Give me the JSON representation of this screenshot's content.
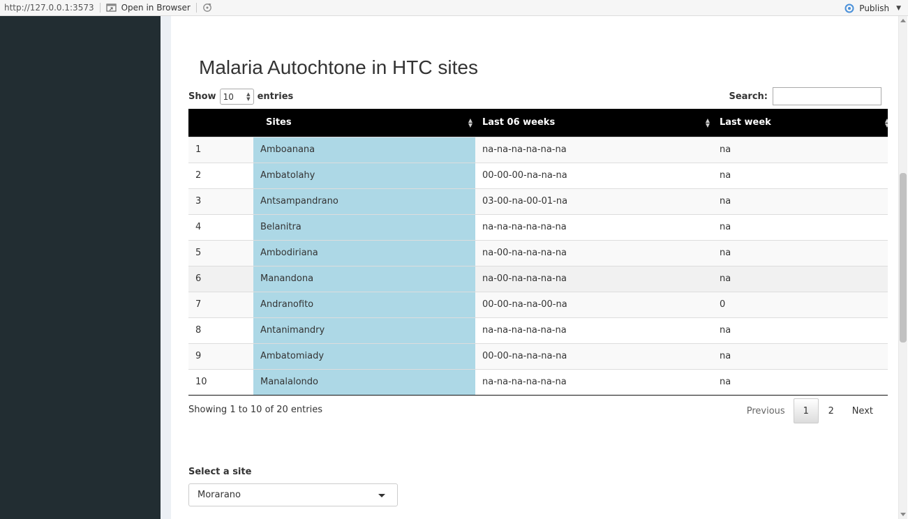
{
  "toolbar": {
    "url": "http://127.0.0.1:3573",
    "open_browser_label": "Open in Browser",
    "publish_label": "Publish"
  },
  "page": {
    "title": "Malaria Autochtone in HTC sites"
  },
  "table_controls": {
    "show_label": "Show",
    "entries_label": "entries",
    "page_length": "10",
    "search_label": "Search:",
    "search_value": ""
  },
  "table": {
    "columns": [
      "",
      "Sites",
      "Last 06 weeks",
      "Last week"
    ],
    "rows": [
      {
        "index": "1",
        "site": "Amboanana",
        "last6": "na-na-na-na-na-na",
        "last": "na"
      },
      {
        "index": "2",
        "site": "Ambatolahy",
        "last6": "00-00-00-na-na-na",
        "last": "na"
      },
      {
        "index": "3",
        "site": "Antsampandrano",
        "last6": "03-00-na-00-01-na",
        "last": "na"
      },
      {
        "index": "4",
        "site": "Belanitra",
        "last6": "na-na-na-na-na-na",
        "last": "na"
      },
      {
        "index": "5",
        "site": "Ambodiriana",
        "last6": "na-00-na-na-na-na",
        "last": "na"
      },
      {
        "index": "6",
        "site": "Manandona",
        "last6": "na-00-na-na-na-na",
        "last": "na"
      },
      {
        "index": "7",
        "site": "Andranofito",
        "last6": "00-00-na-na-00-na",
        "last": "0"
      },
      {
        "index": "8",
        "site": "Antanimandry",
        "last6": "na-na-na-na-na-na",
        "last": "na"
      },
      {
        "index": "9",
        "site": "Ambatomiady",
        "last6": "00-00-na-na-na-na",
        "last": "na"
      },
      {
        "index": "10",
        "site": "Manalalondo",
        "last6": "na-na-na-na-na-na",
        "last": "na"
      }
    ],
    "site_column_color": "#add8e6",
    "header_color": "#000000"
  },
  "pagination": {
    "info": "Showing 1 to 10 of 20 entries",
    "previous": "Previous",
    "pages": [
      "1",
      "2"
    ],
    "current": "1",
    "next": "Next"
  },
  "site_selector": {
    "label": "Select a site",
    "value": "Morarano"
  },
  "colors": {
    "sidebar": "#222d32",
    "publish_icon": "#4a90d9"
  },
  "icons": [
    "open-in-browser-icon",
    "refresh-icon",
    "publish-icon",
    "chevron-down-icon",
    "sort-icon",
    "dropdown-caret-icon"
  ]
}
